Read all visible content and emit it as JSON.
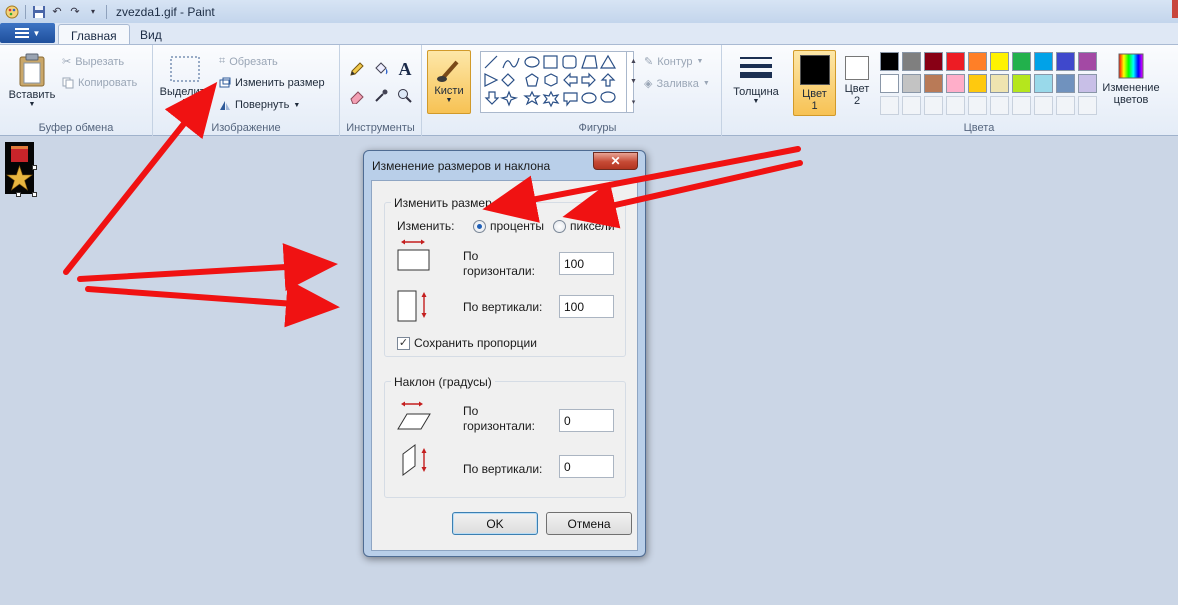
{
  "window": {
    "title": "zvezda1.gif - Paint"
  },
  "tabs": [
    {
      "label": "Главная",
      "active": true
    },
    {
      "label": "Вид",
      "active": false
    }
  ],
  "ribbon": {
    "clipboard": {
      "label": "Буфер обмена",
      "paste": "Вставить",
      "cut": "Вырезать",
      "copy": "Копировать"
    },
    "image": {
      "label": "Изображение",
      "select": "Выделить",
      "crop": "Обрезать",
      "resize": "Изменить размер",
      "rotate": "Повернуть"
    },
    "tools": {
      "label": "Инструменты"
    },
    "brushes": {
      "label": "Кисти"
    },
    "shapes": {
      "label": "Фигуры",
      "outline": "Контур",
      "fill": "Заливка"
    },
    "size": {
      "label": "Толщина"
    },
    "color1": {
      "label_line1": "Цвет",
      "label_line2": "1",
      "value": "#000000"
    },
    "color2": {
      "label_line1": "Цвет",
      "label_line2": "2",
      "value": "#ffffff"
    },
    "colors": {
      "label": "Цвета",
      "edit_line1": "Изменение",
      "edit_line2": "цветов",
      "row1": [
        "#000000",
        "#7f7f7f",
        "#880015",
        "#ed1c24",
        "#ff7f27",
        "#fff200",
        "#22b14c",
        "#00a2e8",
        "#3f48cc",
        "#a349a4"
      ],
      "row2": [
        "#ffffff",
        "#c3c3c3",
        "#b97a57",
        "#ffaec9",
        "#ffc90e",
        "#efe4b0",
        "#b5e61d",
        "#99d9ea",
        "#7092be",
        "#c8bfe7"
      ]
    }
  },
  "dialog": {
    "title": "Изменение размеров и наклона",
    "resize": {
      "legend": "Изменить размер",
      "by_label": "Изменить:",
      "percent": "проценты",
      "pixels": "пиксели",
      "horizontal_line1": "По",
      "horizontal_line2": "горизонтали:",
      "horizontal_value": "100",
      "vertical": "По вертикали:",
      "vertical_value": "100",
      "keep_ratio": "Сохранить пропорции"
    },
    "skew": {
      "legend": "Наклон (градусы)",
      "horizontal_line1": "По",
      "horizontal_line2": "горизонтали:",
      "horizontal_value": "0",
      "vertical": "По вертикали:",
      "vertical_value": "0"
    },
    "ok": "OK",
    "cancel": "Отмена"
  }
}
